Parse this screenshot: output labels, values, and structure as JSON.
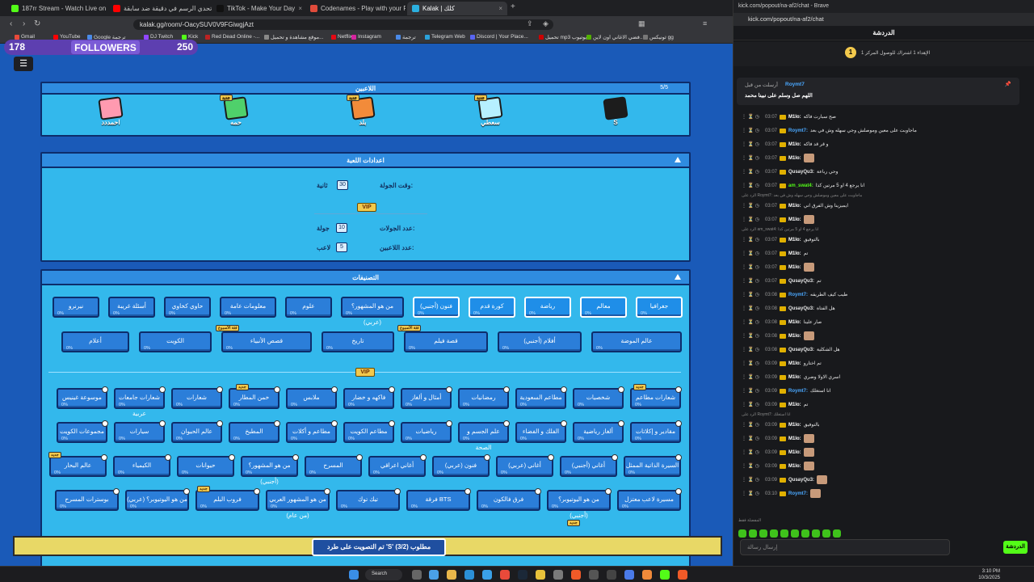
{
  "left_browser": {
    "tabs": [
      {
        "title": "187rr Stream - Watch Live on Kick",
        "color": "#53fc18"
      },
      {
        "title": "تحدي الرسم في دقيقة ضد سابقة",
        "color": "#ff0000"
      },
      {
        "title": "TikTok - Make Your Day",
        "color": "#111111"
      },
      {
        "title": "Codenames - Play with your Friends",
        "color": "#e04b3b"
      },
      {
        "title": "Kalak | كلك",
        "color": "#2bb0e0"
      }
    ],
    "url": "kalak.gg/room/-OacySUV0V9FGiwgjAzt",
    "bookmarks": [
      "Gmail",
      "YouTube",
      "Google ترجمة",
      "DJ Twitch",
      "Kick",
      "Red Dead Online -...",
      "موقع مشاهدة و تحميل...",
      "Netflix",
      "Instagram",
      "ترجمة",
      "Telegram Web",
      "Discord | Your Place...",
      "تحميل mp3 يوتيوب",
      "فضي الاغاني اون لاين...",
      "ثونيكس gg"
    ]
  },
  "game": {
    "followers": {
      "count": "178",
      "label": "FOLLOWERS",
      "goal": "250"
    },
    "players_panel": {
      "title": "اللاعبين",
      "corner": "5/5"
    },
    "players": [
      {
        "name": "احمددد",
        "color": "#ff9ab0",
        "badge": ""
      },
      {
        "name": "حمه",
        "color": "#4fd06b",
        "badge": "جديد"
      },
      {
        "name": "بلد",
        "color": "#f28b3a",
        "badge": "جديد"
      },
      {
        "name": "سعطي",
        "color": "#b6f0ff",
        "badge": "جديد"
      },
      {
        "name": "S",
        "color": "#1c1c1c",
        "badge": ""
      }
    ],
    "settings_panel": {
      "title": "اعدادات اللعبة",
      "round_time_label": "وقت الجولة:",
      "round_time_value": "30",
      "round_time_unit": "ثانية",
      "vip": "VIP",
      "rounds_label": "عدد الجولات:",
      "rounds_value": "10",
      "rounds_unit": "جولة",
      "players_label": "عدد اللاعبين:",
      "players_value": "5",
      "players_unit": "لاعب"
    },
    "categories_panel": {
      "title": "التصنيفات"
    },
    "row1": [
      "جغرافيا",
      "معالم",
      "رياضة",
      "كورة قدم",
      "فنون (أجنبي)",
      "من هو المشهور؟ (عربي)",
      "علوم",
      "معلومات عامة",
      "حاوي كخاوي",
      "أسئلة غريبة",
      "نيرنرو"
    ],
    "row2": [
      "عالم الموضة",
      "أفلام (أجنبي)",
      "قصة فيلم",
      "تاريخ",
      "قصص الأنبياء",
      "الكويت",
      "أعلام"
    ],
    "locked_rows": [
      [
        "شعارات مطاعم",
        "شخصيات",
        "مطاعم السعودية",
        "رمضانيات",
        "أمثال و ألغاز",
        "فاكهه و خضار",
        "ملابس",
        "خمن المطار",
        "شعارات",
        "شعارات جامعات عربية",
        "موسوعة غينيس"
      ],
      [
        "مقادير و إكلاتات",
        "ألغاز رياضية",
        "الفلك و الفضاء",
        "علم الجسم و الصحة",
        "رياضيات",
        "مطاعم الكويت",
        "مطاعم و أكلات",
        "المطبخ",
        "عالم الحيوان",
        "سيارات",
        "مجموعات الكويت"
      ],
      [
        "السيرة الذاتية الممثل",
        "أغاني (أجنبي)",
        "أغاني (عربي)",
        "فنون (عربي)",
        "أغاني اعراقي",
        "المسرح",
        "من هو المشهور؟ (أجنبي)",
        "حيوانات",
        "الكيمياء",
        "عالم البحار"
      ],
      [
        "مسيرة لاعب معتزل",
        "من هو اليوتيوبر؟ (أجنبي)",
        "فرق فالكون",
        "فرقة BTS",
        "تيك توك",
        "من هو المشهور العربي (من عام)",
        "فروب البلم",
        "من هو اليوتيوبر؟ (عربي)",
        "بوسترات المسرح"
      ]
    ],
    "badge_new": "جديد",
    "badge_week": "فئة الأسبوع",
    "pct": "0%",
    "toast": "تم التصويت على طرد 'S' مطلوب (3/2)"
  },
  "chat_window": {
    "tab_title": "kick.com/popout/na-af2/chat - Brave",
    "url": "kick.com/popout/na-af2/chat",
    "header": "الدردشة",
    "goal_text": "الإهداء 1 اشتراك للوصول المركز 1",
    "goal_num": "1",
    "pinned_by": "أرسلت من قبل",
    "pinned_user": "Roymt7",
    "pinned_text": "اللهم صل وسلم على نبينا محمد",
    "messages": [
      {
        "time": "03:07",
        "user": "M1lo:",
        "color": "#ffffff",
        "text": "صح سبارت فاكه",
        "reply": "",
        "emote": false
      },
      {
        "time": "03:07",
        "user": "Roymt7:",
        "color": "#4aa8ff",
        "text": "ماجاوبت على معين وموصلش وجي سهله وش في بعد",
        "reply": "",
        "emote": false
      },
      {
        "time": "03:07",
        "user": "M1lo:",
        "color": "#ffffff",
        "text": "و قر قد فاكه",
        "reply": "",
        "emote": false
      },
      {
        "time": "03:07",
        "user": "M1lo:",
        "color": "#ffffff",
        "text": "",
        "reply": "",
        "emote": true
      },
      {
        "time": "03:07",
        "user": "QusayQu3:",
        "color": "#e8e8e8",
        "text": "وحي رباعة",
        "reply": "",
        "emote": false
      },
      {
        "time": "03:07",
        "user": "am_swat4:",
        "color": "#53fc18",
        "text": "انا يرجع 4 او 5 مرتين كذا",
        "reply": "",
        "emote": false
      },
      {
        "time": "03:07",
        "user": "M1lo:",
        "color": "#ffffff",
        "text": "ايميزينا وش الفرق اني",
        "reply": "الرد على Roymt7: ماجاوبت على معين وموصلش وجي سهله وش في بعد",
        "emote": false
      },
      {
        "time": "03:07",
        "user": "M1lo:",
        "color": "#ffffff",
        "text": "",
        "reply": "",
        "emote": true
      },
      {
        "time": "03:07",
        "user": "M1lo:",
        "color": "#ffffff",
        "text": "بالتوفيق",
        "reply": "الرد على am_swat4: انا يرجع 4 او 5 مرتين كذا",
        "emote": false
      },
      {
        "time": "03:07",
        "user": "M1lo:",
        "color": "#ffffff",
        "text": "تم",
        "reply": "",
        "emote": false
      },
      {
        "time": "03:07",
        "user": "M1lo:",
        "color": "#ffffff",
        "text": "",
        "reply": "",
        "emote": true
      },
      {
        "time": "03:07",
        "user": "QusayQu3:",
        "color": "#e8e8e8",
        "text": "تم",
        "reply": "",
        "emote": false
      },
      {
        "time": "03:08",
        "user": "Roymt7:",
        "color": "#4aa8ff",
        "text": "طيب كيف الطريقه",
        "reply": "",
        "emote": false
      },
      {
        "time": "03:08",
        "user": "QusayQu3:",
        "color": "#e8e8e8",
        "text": "هل الفتاة",
        "reply": "",
        "emote": false
      },
      {
        "time": "03:08",
        "user": "M1lo:",
        "color": "#ffffff",
        "text": "صار علينا",
        "reply": "",
        "emote": false
      },
      {
        "time": "03:08",
        "user": "M1lo:",
        "color": "#ffffff",
        "text": "",
        "reply": "",
        "emote": true
      },
      {
        "time": "03:08",
        "user": "QusayQu3:",
        "color": "#e8e8e8",
        "text": "هل الشكلية",
        "reply": "",
        "emote": false
      },
      {
        "time": "03:09",
        "user": "M1lo:",
        "color": "#ffffff",
        "text": "تم اختارو",
        "reply": "",
        "emote": false
      },
      {
        "time": "03:09",
        "user": "M1lo:",
        "color": "#ffffff",
        "text": "اسري الاولا وضري",
        "reply": "",
        "emote": false
      },
      {
        "time": "03:09",
        "user": "Roymt7:",
        "color": "#4aa8ff",
        "text": "انا استغلك",
        "reply": "",
        "emote": false
      },
      {
        "time": "03:09",
        "user": "M1lo:",
        "color": "#ffffff",
        "text": "تم",
        "reply": "",
        "emote": false
      },
      {
        "time": "03:09",
        "user": "M1lo:",
        "color": "#ffffff",
        "text": "بالتوفيق",
        "reply": "الرد على Roymt7: انا استغلك",
        "emote": false
      },
      {
        "time": "03:09",
        "user": "M1lo:",
        "color": "#ffffff",
        "text": "",
        "reply": "",
        "emote": true
      },
      {
        "time": "03:09",
        "user": "M1lo:",
        "color": "#ffffff",
        "text": "",
        "reply": "",
        "emote": true
      },
      {
        "time": "03:09",
        "user": "M1lo:",
        "color": "#ffffff",
        "text": "",
        "reply": "",
        "emote": true
      },
      {
        "time": "03:09",
        "user": "QusayQu3:",
        "color": "#e8e8e8",
        "text": "",
        "reply": "",
        "emote": true
      },
      {
        "time": "03:10",
        "user": "Roymt7:",
        "color": "#4aa8ff",
        "text": "",
        "reply": "",
        "emote": true
      }
    ],
    "emote_label": "المفضلة فقط",
    "input_placeholder": "إرسال رسالة",
    "send_label": "الدردشة"
  },
  "taskbar": {
    "search": "Search",
    "time": "3:10 PM",
    "date": "10/3/2025"
  }
}
